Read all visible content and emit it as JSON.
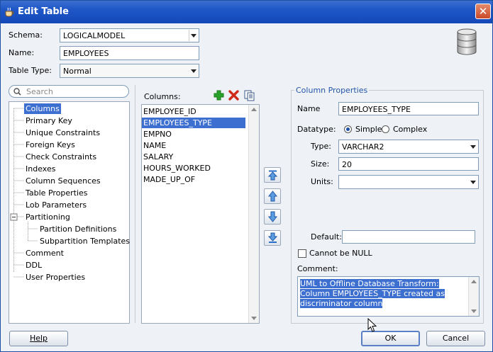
{
  "window": {
    "title": "Edit Table"
  },
  "form": {
    "schema_label": "Schema:",
    "schema_value": "LOGICALMODEL",
    "name_label": "Name:",
    "name_value": "EMPLOYEES",
    "table_type_label": "Table Type:",
    "table_type_value": "Normal"
  },
  "search": {
    "placeholder": "Search"
  },
  "nav": {
    "items": [
      "Columns",
      "Primary Key",
      "Unique Constraints",
      "Foreign Keys",
      "Check Constraints",
      "Indexes",
      "Column Sequences",
      "Table Properties",
      "Lob Parameters",
      "Partitioning",
      "Partition Definitions",
      "Subpartition Templates",
      "Comment",
      "DDL",
      "User Properties"
    ],
    "selected": "Columns"
  },
  "columns": {
    "header": "Columns:",
    "items": [
      "EMPLOYEE_ID",
      "EMPLOYEES_TYPE",
      "EMPNO",
      "NAME",
      "SALARY",
      "HOURS_WORKED",
      "MADE_UP_OF"
    ],
    "selected": "EMPLOYEES_TYPE"
  },
  "props": {
    "title": "Column Properties",
    "name_label": "Name",
    "name_value": "EMPLOYEES_TYPE",
    "datatype_label": "Datatype:",
    "simple_label": "Simple",
    "complex_label": "Complex",
    "datatype_selected": "Simple",
    "type_label": "Type:",
    "type_value": "VARCHAR2",
    "size_label": "Size:",
    "size_value": "20",
    "units_label": "Units:",
    "units_value": "",
    "default_label": "Default:",
    "default_value": "",
    "notnull_label": "Cannot be NULL",
    "comment_label": "Comment:",
    "comment_value": "UML to Offline Database Transform: Column EMPLOYEES_TYPE created as discriminator column"
  },
  "buttons": {
    "help": "Help",
    "ok": "OK",
    "cancel": "Cancel"
  },
  "colors": {
    "titlebar": "#1e56c7",
    "selection": "#3d6fd0",
    "add": "#2aa12a",
    "remove": "#d02a1a"
  }
}
